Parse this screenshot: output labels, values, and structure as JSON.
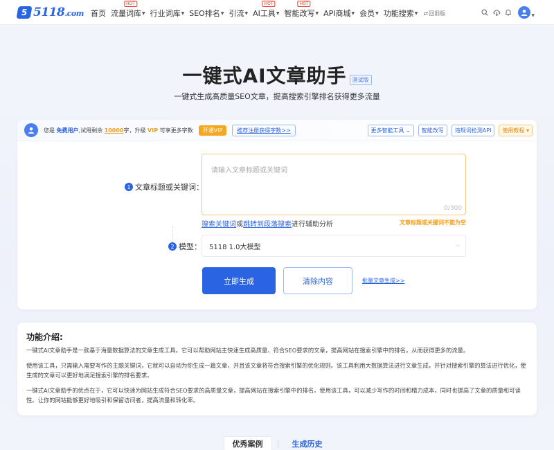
{
  "brand": {
    "logo_mark": "5",
    "logo_text": "5118",
    "logo_suffix": ".com"
  },
  "nav": {
    "items": [
      {
        "label": "首页",
        "caret": false,
        "hot": false
      },
      {
        "label": "流量词库",
        "caret": true,
        "hot": true
      },
      {
        "label": "行业词库",
        "caret": true,
        "hot": false
      },
      {
        "label": "SEO排名",
        "caret": true,
        "hot": false
      },
      {
        "label": "引流",
        "caret": true,
        "hot": false
      },
      {
        "label": "AI工具",
        "caret": true,
        "hot": true
      },
      {
        "label": "智能改写",
        "caret": true,
        "hot": true
      },
      {
        "label": "API商城",
        "caret": true,
        "hot": false
      },
      {
        "label": "会员",
        "caret": true,
        "hot": false
      },
      {
        "label": "功能搜索",
        "caret": true,
        "hot": false
      }
    ],
    "hot_label": "HOT",
    "old_version": "回旧版",
    "icons": [
      "search-icon",
      "download-icon",
      "bell-icon"
    ]
  },
  "hero": {
    "title": "一键式AI文章助手",
    "beta_badge": "测试版",
    "subtitle": "一键式生成高质量SEO文章，提高搜索引擎排名获得更多流量"
  },
  "card": {
    "quota": {
      "prefix": "您是",
      "user_type": "免费用户",
      "mid": ",试用剩余",
      "remaining": "10000",
      "suffix1": "字，升级",
      "vip": "VIP",
      "suffix2": "可享更多字数"
    },
    "open_vip": "开通VIP",
    "invite": "推荐注册获得字数>>",
    "tools": {
      "more_tools": "更多智能工具",
      "rewrite": "智能改写",
      "banned_words": "违规词检测API",
      "tutorial": "使用教程"
    },
    "field1": {
      "step": "1",
      "label": "文章标题或关键词：",
      "placeholder": "请输入文章标题或关键词",
      "counter": "0/300"
    },
    "helper": {
      "link1": "搜索关键词",
      "or": "或",
      "link2": "跳转到段落搜索",
      "tail": "进行辅助分析"
    },
    "error": "文章标题或关键词不能为空",
    "field2": {
      "step": "2",
      "label": "模型：",
      "value": "5118 1.0大模型"
    },
    "generate": "立即生成",
    "clear": "清除内容",
    "batch": "批量文章生成>>"
  },
  "intro": {
    "title": "功能介绍:",
    "paragraphs": [
      "一键式AI文章助手是一款基于海量数据算法的文章生成工具。它可以帮助网站主快速生成高质量、符合SEO要求的文章，提高网站在搜索引擎中的排名，从而获得更多的流量。",
      "使用该工具，只需输入需要写作的主题关键词，它就可以自动为你生成一篇文章，并且该文章将符合搜索引擎的优化规则。该工具利用大数据算法进行文章生成，并针对搜索引擎的算法进行优化，使生成的文章可以更好地满足搜索引擎的排名要求。",
      "一键式AI文章助手的优点在于，它可以快速为网站生成符合SEO要求的高质量文章，提高网站在搜索引擎中的排名。使用该工具，可以减少写作的时间和精力成本，同时也提高了文章的质量和可读性。让你的网站能够更好地吸引和保留访问者，提高流量和转化率。"
    ]
  },
  "tabs": {
    "cases": "优秀案例",
    "history": "生成历史"
  },
  "colors": {
    "primary": "#2a64e2",
    "accent": "#f5a623",
    "hot": "#e8402c"
  }
}
